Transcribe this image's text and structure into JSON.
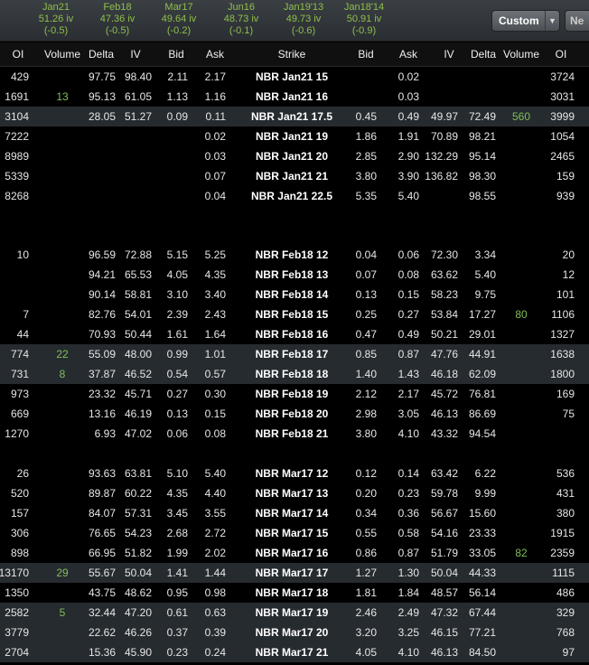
{
  "expirations": [
    {
      "name": "Jan21",
      "iv": "51.26 iv",
      "change": "(-0.5)"
    },
    {
      "name": "Feb18",
      "iv": "47.36 iv",
      "change": "(-0.5)"
    },
    {
      "name": "Mar17",
      "iv": "49.64 iv",
      "change": "(-0.2)"
    },
    {
      "name": "Jun16",
      "iv": "48.73 iv",
      "change": "(-0.1)"
    },
    {
      "name": "Jan19'13",
      "iv": "49.73 iv",
      "change": "(-0.6)"
    },
    {
      "name": "Jan18'14",
      "iv": "50.91 iv",
      "change": "(-0.9)"
    }
  ],
  "toolbar": {
    "custom_label": "Custom",
    "next_label": "Ne"
  },
  "headers": [
    "OI",
    "Volume",
    "Delta",
    "IV",
    "Bid",
    "Ask",
    "Strike",
    "Bid",
    "Ask",
    "IV",
    "Delta",
    "Volume",
    "OI"
  ],
  "rows": [
    {
      "hl": false,
      "c": [
        "429",
        "",
        "97.75",
        "98.40",
        "2.11",
        "2.17",
        "NBR Jan21 15",
        "",
        "0.02",
        "",
        "",
        "",
        "3724"
      ]
    },
    {
      "hl": false,
      "c": [
        "1691",
        "13",
        "95.13",
        "61.05",
        "1.13",
        "1.16",
        "NBR Jan21 16",
        "",
        "0.03",
        "",
        "",
        "",
        "3031"
      ]
    },
    {
      "hl": true,
      "c": [
        "3104",
        "",
        "28.05",
        "51.27",
        "0.09",
        "0.11",
        "NBR Jan21 17.5",
        "0.45",
        "0.49",
        "49.97",
        "72.49",
        "560",
        "3999"
      ]
    },
    {
      "hl": false,
      "c": [
        "7222",
        "",
        "",
        "",
        "",
        "0.02",
        "NBR Jan21 19",
        "1.86",
        "1.91",
        "70.89",
        "98.21",
        "",
        "1054"
      ]
    },
    {
      "hl": false,
      "c": [
        "8989",
        "",
        "",
        "",
        "",
        "0.03",
        "NBR Jan21 20",
        "2.85",
        "2.90",
        "132.29",
        "95.14",
        "",
        "2465"
      ]
    },
    {
      "hl": false,
      "c": [
        "5339",
        "",
        "",
        "",
        "",
        "0.07",
        "NBR Jan21 21",
        "3.80",
        "3.90",
        "136.82",
        "98.30",
        "",
        "159"
      ]
    },
    {
      "hl": false,
      "c": [
        "8268",
        "",
        "",
        "",
        "",
        "0.04",
        "NBR Jan21 22.5",
        "5.35",
        "5.40",
        "",
        "98.55",
        "",
        "939"
      ]
    },
    {
      "hl": false,
      "c": [
        "10",
        "",
        "96.59",
        "72.88",
        "5.15",
        "5.25",
        "NBR Feb18 12",
        "0.04",
        "0.06",
        "72.30",
        "3.34",
        "",
        "20"
      ]
    },
    {
      "hl": false,
      "c": [
        "",
        "",
        "94.21",
        "65.53",
        "4.05",
        "4.35",
        "NBR Feb18 13",
        "0.07",
        "0.08",
        "63.62",
        "5.40",
        "",
        "12"
      ]
    },
    {
      "hl": false,
      "c": [
        "",
        "",
        "90.14",
        "58.81",
        "3.10",
        "3.40",
        "NBR Feb18 14",
        "0.13",
        "0.15",
        "58.23",
        "9.75",
        "",
        "101"
      ]
    },
    {
      "hl": false,
      "c": [
        "7",
        "",
        "82.76",
        "54.01",
        "2.39",
        "2.43",
        "NBR Feb18 15",
        "0.25",
        "0.27",
        "53.84",
        "17.27",
        "80",
        "1106"
      ]
    },
    {
      "hl": false,
      "c": [
        "44",
        "",
        "70.93",
        "50.44",
        "1.61",
        "1.64",
        "NBR Feb18 16",
        "0.47",
        "0.49",
        "50.21",
        "29.01",
        "",
        "1327"
      ]
    },
    {
      "hl": true,
      "c": [
        "774",
        "22",
        "55.09",
        "48.00",
        "0.99",
        "1.01",
        "NBR Feb18 17",
        "0.85",
        "0.87",
        "47.76",
        "44.91",
        "",
        "1638"
      ]
    },
    {
      "hl": true,
      "c": [
        "731",
        "8",
        "37.87",
        "46.52",
        "0.54",
        "0.57",
        "NBR Feb18 18",
        "1.40",
        "1.43",
        "46.18",
        "62.09",
        "",
        "1800"
      ]
    },
    {
      "hl": false,
      "c": [
        "973",
        "",
        "23.32",
        "45.71",
        "0.27",
        "0.30",
        "NBR Feb18 19",
        "2.12",
        "2.17",
        "45.72",
        "76.81",
        "",
        "169"
      ]
    },
    {
      "hl": false,
      "c": [
        "669",
        "",
        "13.16",
        "46.19",
        "0.13",
        "0.15",
        "NBR Feb18 20",
        "2.98",
        "3.05",
        "46.13",
        "86.69",
        "",
        "75"
      ]
    },
    {
      "hl": false,
      "c": [
        "1270",
        "",
        "6.93",
        "47.02",
        "0.06",
        "0.08",
        "NBR Feb18 21",
        "3.80",
        "4.10",
        "43.32",
        "94.54",
        "",
        ""
      ]
    },
    {
      "hl": false,
      "c": [
        "26",
        "",
        "93.63",
        "63.81",
        "5.10",
        "5.40",
        "NBR Mar17 12",
        "0.12",
        "0.14",
        "63.42",
        "6.22",
        "",
        "536"
      ]
    },
    {
      "hl": false,
      "c": [
        "520",
        "",
        "89.87",
        "60.22",
        "4.35",
        "4.40",
        "NBR Mar17 13",
        "0.20",
        "0.23",
        "59.78",
        "9.99",
        "",
        "431"
      ]
    },
    {
      "hl": false,
      "c": [
        "157",
        "",
        "84.07",
        "57.31",
        "3.45",
        "3.55",
        "NBR Mar17 14",
        "0.34",
        "0.36",
        "56.67",
        "15.60",
        "",
        "380"
      ]
    },
    {
      "hl": false,
      "c": [
        "306",
        "",
        "76.65",
        "54.23",
        "2.68",
        "2.72",
        "NBR Mar17 15",
        "0.55",
        "0.58",
        "54.16",
        "23.33",
        "",
        "1915"
      ]
    },
    {
      "hl": false,
      "c": [
        "898",
        "",
        "66.95",
        "51.82",
        "1.99",
        "2.02",
        "NBR Mar17 16",
        "0.86",
        "0.87",
        "51.79",
        "33.05",
        "82",
        "2359"
      ]
    },
    {
      "hl": true,
      "c": [
        "13170",
        "29",
        "55.67",
        "50.04",
        "1.41",
        "1.44",
        "NBR Mar17 17",
        "1.27",
        "1.30",
        "50.04",
        "44.33",
        "",
        "1115"
      ]
    },
    {
      "hl": false,
      "c": [
        "1350",
        "",
        "43.75",
        "48.62",
        "0.95",
        "0.98",
        "NBR Mar17 18",
        "1.81",
        "1.84",
        "48.57",
        "56.14",
        "",
        "486"
      ]
    },
    {
      "hl": true,
      "c": [
        "2582",
        "5",
        "32.44",
        "47.20",
        "0.61",
        "0.63",
        "NBR Mar17 19",
        "2.46",
        "2.49",
        "47.32",
        "67.44",
        "",
        "329"
      ]
    },
    {
      "hl": true,
      "c": [
        "3779",
        "",
        "22.62",
        "46.26",
        "0.37",
        "0.39",
        "NBR Mar17 20",
        "3.20",
        "3.25",
        "46.15",
        "77.21",
        "",
        "768"
      ]
    },
    {
      "hl": true,
      "c": [
        "2704",
        "",
        "15.36",
        "45.90",
        "0.23",
        "0.24",
        "NBR Mar17 21",
        "4.05",
        "4.10",
        "46.13",
        "84.50",
        "",
        "97"
      ]
    }
  ]
}
